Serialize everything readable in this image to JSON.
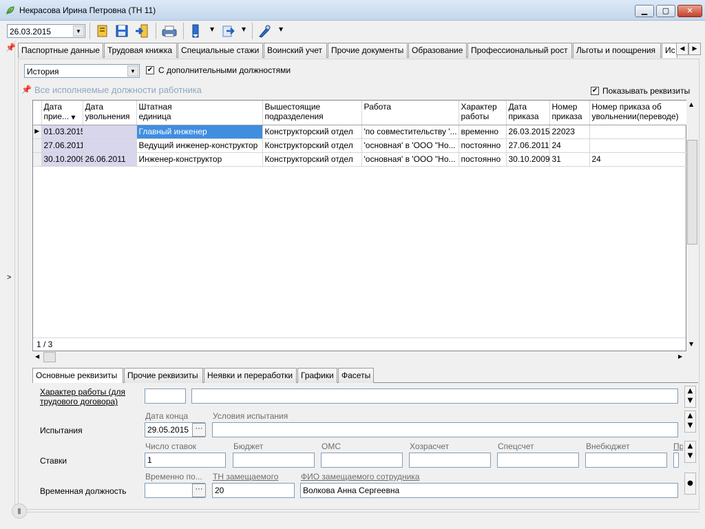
{
  "window": {
    "title": "Некрасова Ирина Петровна (ТН 11)"
  },
  "toolbar": {
    "date_value": "26.03.2015"
  },
  "tabs": [
    "Паспортные данные",
    "Трудовая книжка",
    "Специальные стажи",
    "Воинский учет",
    "Прочие документы",
    "Образование",
    "Профессиональный рост",
    "Льготы и поощрения",
    "Ис"
  ],
  "view": {
    "mode_value": "История",
    "additional_positions_label": "С дополнительными должностями",
    "additional_positions_checked": true
  },
  "grid": {
    "caption": "Все исполняемые должности работника",
    "show_details_label": "Показывать реквизиты",
    "columns": [
      [
        "Дата",
        "прие..."
      ],
      [
        "Дата",
        "увольнения"
      ],
      [
        "Штатная",
        "единица"
      ],
      [
        "Вышестоящие",
        "подразделения"
      ],
      [
        "Работа",
        ""
      ],
      [
        "Характер",
        "работы"
      ],
      [
        "Дата",
        "приказа"
      ],
      [
        "Номер",
        "приказа"
      ],
      [
        "Номер приказа об",
        "увольнении(переводе)"
      ]
    ],
    "rows": [
      [
        "01.03.2015",
        "",
        "Главный инженер",
        "Конструкторский отдел",
        "'по совместительству '...",
        "временно",
        "26.03.2015",
        "22023",
        ""
      ],
      [
        "27.06.2011",
        "",
        "Ведущий инженер-конструктор",
        "Конструкторский отдел",
        "'основная' в 'ООО \"Но...",
        "постоянно",
        "27.06.2011",
        "24",
        ""
      ],
      [
        "30.10.2009",
        "26.06.2011",
        "Инженер-конструктор",
        "Конструкторский отдел",
        "'основная' в 'ООО \"Но...",
        "постоянно",
        "30.10.2009",
        "31",
        "24"
      ]
    ],
    "record_counter": "1 / 3"
  },
  "bottom_tabs": [
    "Основные реквизиты",
    "Прочие реквизиты",
    "Неявки и переработки",
    "Графики",
    "Фасеты"
  ],
  "form": {
    "work_type_label": "Характер работы (для трудового договора)",
    "work_type_code": "",
    "work_type_name": "",
    "trial_label": "Испытания",
    "trial_end_label": "Дата конца",
    "trial_end_value": "29.05.2015",
    "trial_conditions_label": "Условия испытания",
    "trial_conditions_value": "",
    "rates_label": "Ставки",
    "rates_count_label": "Число ставок",
    "rates_count_value": "1",
    "budget_label": "Бюджет",
    "oms_label": "ОМС",
    "selffin_label": "Хозрасчет",
    "special_label": "Спецсчет",
    "offbudget_label": "Внебюджет",
    "pr_label": "Пр",
    "temp_label": "Временная должность",
    "temp_until_label": "Временно по...",
    "temp_until_value": "",
    "replaced_tn_label": "ТН замещаемого",
    "replaced_tn_value": "20",
    "replaced_name_label": "ФИО замещаемого сотрудника",
    "replaced_name_value": "Волкова Анна Сергеевна"
  },
  "icons": [
    "app-leaf-icon",
    "wizard-icon",
    "save-icon",
    "exit-icon",
    "print-icon",
    "bookmark-icon",
    "move-icon",
    "marker-icon",
    "pin-icon"
  ]
}
